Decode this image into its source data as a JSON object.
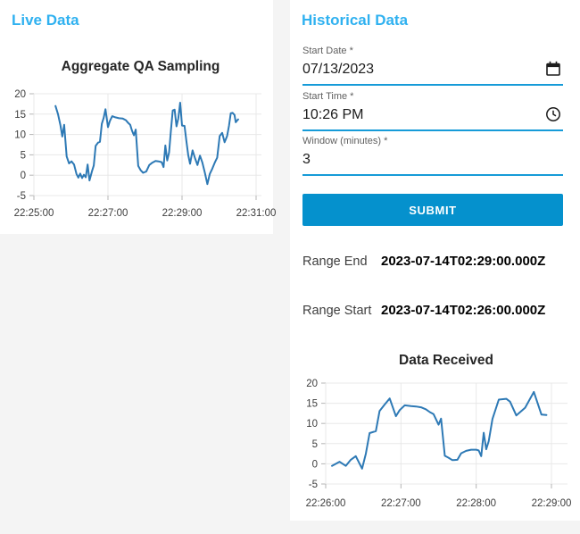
{
  "colors": {
    "page_background": "#f4f4f4",
    "panel_background": "#ffffff",
    "heading_accent": "#2fb1f0",
    "field_underline": "#169bd8",
    "submit_button": "#0591cd",
    "chart_line": "#2d79b5",
    "gridline": "#e8e8e8"
  },
  "live_panel": {
    "heading": "Live Data"
  },
  "historical_panel": {
    "heading": "Historical Data",
    "form": {
      "start_date": {
        "label": "Start Date *",
        "value": "07/13/2023",
        "icon": "calendar-icon"
      },
      "start_time": {
        "label": "Start Time *",
        "value": "10:26 PM",
        "icon": "clock-icon"
      },
      "window": {
        "label": "Window (minutes) *",
        "value": "3"
      },
      "submit_label": "SUBMIT"
    },
    "results": {
      "range_end_label": "Range End",
      "range_end_value": "2023-07-14T02:29:00.000Z",
      "range_start_label": "Range Start",
      "range_start_value": "2023-07-14T02:26:00.000Z"
    }
  },
  "chart_data": [
    {
      "type": "line",
      "title": "Aggregate QA Sampling",
      "xlabel": "",
      "ylabel": "",
      "x_unit": "seconds after 22:25:00",
      "xlim": [
        0,
        360
      ],
      "ylim": [
        -5,
        20
      ],
      "yticks": [
        20,
        15,
        10,
        5,
        0,
        -5
      ],
      "xticks": [
        {
          "t": 0,
          "label": "22:25:00"
        },
        {
          "t": 120,
          "label": "22:27:00"
        },
        {
          "t": 240,
          "label": "22:29:00"
        },
        {
          "t": 360,
          "label": "22:31:00"
        }
      ],
      "grid": true,
      "legend": "none",
      "line_color": "#2d79b5",
      "points": [
        [
          35,
          17.0
        ],
        [
          39,
          15.0
        ],
        [
          43,
          12.3
        ],
        [
          46,
          9.5
        ],
        [
          49,
          12.4
        ],
        [
          53,
          4.6
        ],
        [
          57,
          2.9
        ],
        [
          61,
          3.4
        ],
        [
          65,
          2.6
        ],
        [
          69,
          0.3
        ],
        [
          72,
          -0.6
        ],
        [
          75,
          0.4
        ],
        [
          78,
          -0.7
        ],
        [
          81,
          0.1
        ],
        [
          84,
          -0.5
        ],
        [
          87,
          2.6
        ],
        [
          90,
          -1.3
        ],
        [
          94,
          0.9
        ],
        [
          97,
          2.4
        ],
        [
          100,
          7.2
        ],
        [
          104,
          8.0
        ],
        [
          107,
          8.2
        ],
        [
          110,
          12.6
        ],
        [
          113,
          14.1
        ],
        [
          116,
          16.2
        ],
        [
          120,
          11.8
        ],
        [
          123,
          13.3
        ],
        [
          127,
          14.5
        ],
        [
          132,
          14.2
        ],
        [
          138,
          14.0
        ],
        [
          144,
          13.9
        ],
        [
          149,
          13.5
        ],
        [
          153,
          12.8
        ],
        [
          156,
          12.4
        ],
        [
          159,
          10.9
        ],
        [
          162,
          9.8
        ],
        [
          165,
          11.2
        ],
        [
          169,
          2.3
        ],
        [
          173,
          1.2
        ],
        [
          177,
          0.6
        ],
        [
          182,
          0.9
        ],
        [
          187,
          2.5
        ],
        [
          192,
          3.1
        ],
        [
          197,
          3.5
        ],
        [
          202,
          3.4
        ],
        [
          207,
          3.2
        ],
        [
          210,
          2.0
        ],
        [
          213,
          7.3
        ],
        [
          216,
          3.6
        ],
        [
          219,
          5.6
        ],
        [
          222,
          11.1
        ],
        [
          225,
          15.9
        ],
        [
          228,
          16.1
        ],
        [
          231,
          12.0
        ],
        [
          234,
          13.9
        ],
        [
          237,
          17.8
        ],
        [
          240,
          12.2
        ],
        [
          244,
          12.1
        ],
        [
          247,
          8.5
        ],
        [
          250,
          5.0
        ],
        [
          253,
          2.8
        ],
        [
          257,
          6.1
        ],
        [
          261,
          4.2
        ],
        [
          265,
          2.5
        ],
        [
          269,
          4.8
        ],
        [
          273,
          3.1
        ],
        [
          277,
          0.6
        ],
        [
          281,
          -2.2
        ],
        [
          285,
          0.3
        ],
        [
          289,
          1.6
        ],
        [
          293,
          3.1
        ],
        [
          297,
          4.3
        ],
        [
          301,
          9.6
        ],
        [
          305,
          10.4
        ],
        [
          309,
          8.1
        ],
        [
          313,
          9.6
        ],
        [
          316,
          12.1
        ],
        [
          319,
          15.2
        ],
        [
          322,
          15.3
        ],
        [
          325,
          14.8
        ],
        [
          327,
          13.0
        ],
        [
          329,
          13.4
        ],
        [
          331,
          13.7
        ]
      ]
    },
    {
      "type": "line",
      "title": "Data Received",
      "xlabel": "",
      "ylabel": "",
      "x_unit": "seconds after 22:26:00",
      "xlim": [
        0,
        180
      ],
      "ylim": [
        -5,
        20
      ],
      "yticks": [
        20,
        15,
        10,
        5,
        0,
        -5
      ],
      "xticks": [
        {
          "t": 0,
          "label": "22:26:00"
        },
        {
          "t": 60,
          "label": "22:27:00"
        },
        {
          "t": 120,
          "label": "22:28:00"
        },
        {
          "t": 180,
          "label": "22:29:00"
        }
      ],
      "grid": true,
      "legend": "none",
      "line_color": "#2d79b5",
      "points": [
        [
          5,
          -0.5
        ],
        [
          11,
          0.5
        ],
        [
          16,
          -0.5
        ],
        [
          20,
          1.0
        ],
        [
          24,
          1.9
        ],
        [
          29,
          -1.2
        ],
        [
          32,
          2.5
        ],
        [
          35,
          7.6
        ],
        [
          40,
          8.1
        ],
        [
          43,
          13.1
        ],
        [
          47,
          14.7
        ],
        [
          51,
          16.2
        ],
        [
          56,
          11.8
        ],
        [
          59,
          13.3
        ],
        [
          63,
          14.5
        ],
        [
          68,
          14.3
        ],
        [
          72,
          14.2
        ],
        [
          76,
          14.0
        ],
        [
          80,
          13.5
        ],
        [
          83,
          12.8
        ],
        [
          86,
          12.3
        ],
        [
          88,
          11.0
        ],
        [
          90,
          9.7
        ],
        [
          92,
          11.2
        ],
        [
          95,
          2.0
        ],
        [
          98,
          1.5
        ],
        [
          101,
          0.9
        ],
        [
          105,
          1.0
        ],
        [
          108,
          2.6
        ],
        [
          112,
          3.2
        ],
        [
          116,
          3.5
        ],
        [
          120,
          3.5
        ],
        [
          122,
          3.3
        ],
        [
          124,
          1.9
        ],
        [
          126,
          7.7
        ],
        [
          128,
          3.6
        ],
        [
          130,
          5.6
        ],
        [
          133,
          11.1
        ],
        [
          138,
          15.9
        ],
        [
          144,
          16.1
        ],
        [
          147,
          15.4
        ],
        [
          152,
          12.0
        ],
        [
          159,
          13.9
        ],
        [
          166,
          17.8
        ],
        [
          172,
          12.2
        ],
        [
          176,
          12.1
        ]
      ]
    }
  ]
}
